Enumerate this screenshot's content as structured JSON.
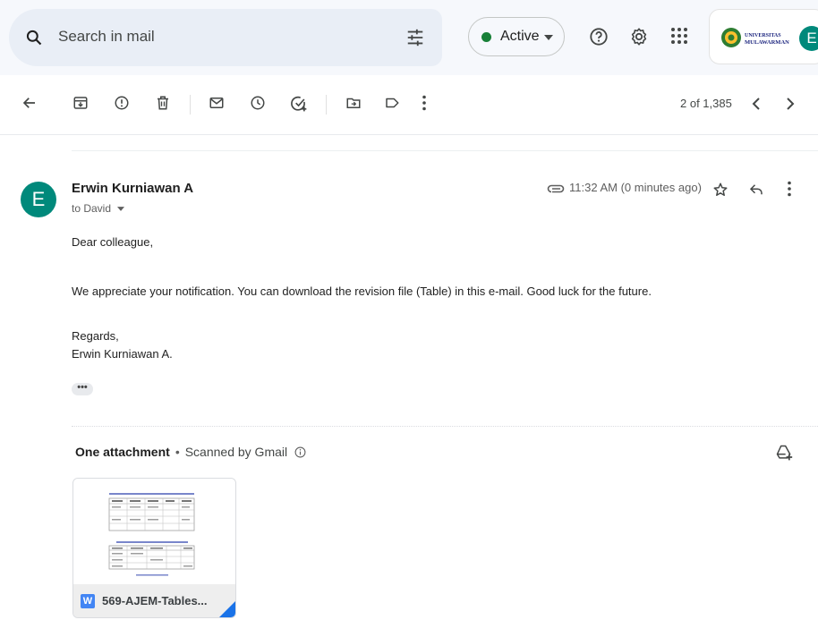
{
  "search": {
    "placeholder": "Search in mail"
  },
  "status": {
    "label": "Active",
    "dot_color": "#188038"
  },
  "header_icons": [
    "tune-icon",
    "help-icon",
    "settings-icon",
    "apps-grid-icon"
  ],
  "account": {
    "avatar_letter": "E",
    "org_logo_text": "UNIVERSITAS MULAWARMAN"
  },
  "toolbar": {
    "icons": [
      "back-arrow-icon",
      "archive-icon",
      "report-spam-icon",
      "delete-icon",
      "mark-unread-icon",
      "snooze-icon",
      "add-to-tasks-icon",
      "move-to-icon",
      "label-icon",
      "more-vert-icon"
    ],
    "pager": "2 of 1,385"
  },
  "message": {
    "avatar_letter": "E",
    "sender": "Erwin Kurniawan A",
    "recipient": "to David",
    "timestamp": "11:32 AM (0 minutes ago)",
    "greeting": "Dear colleague,",
    "body": "We appreciate your notification. You can download the revision file (Table) in this e-mail. Good luck for the future.",
    "closing": "Regards,",
    "signature": "Erwin Kurniawan A.",
    "expand_label": "•••"
  },
  "attachments": {
    "title": "One attachment",
    "separator": "•",
    "scanned": "Scanned by Gmail",
    "file": {
      "name": "569-AJEM-Tables...",
      "type_badge": "W"
    }
  },
  "colors": {
    "accent": "#0b57d0",
    "avatar": "#00897b",
    "topbar": "#f6f8fc"
  }
}
